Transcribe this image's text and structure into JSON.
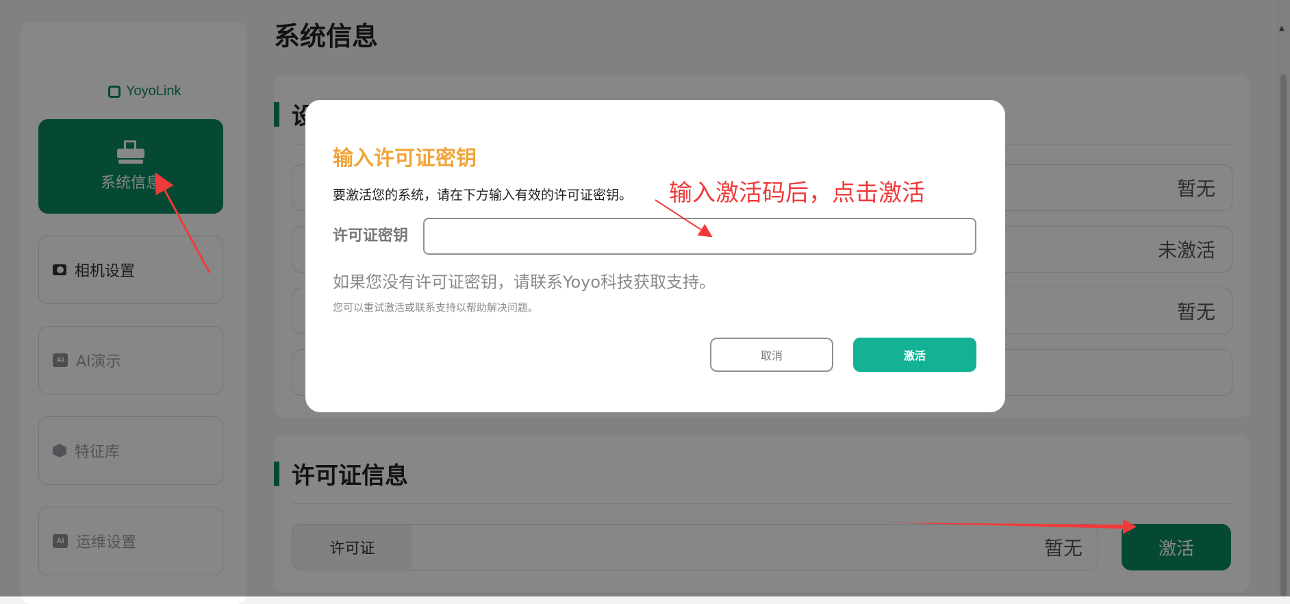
{
  "app": {
    "logo_text": "YoyoLink",
    "page_title": "系统信息"
  },
  "sidebar": {
    "items": [
      {
        "label": "系统信息",
        "icon": "cash-register-icon",
        "state": "active"
      },
      {
        "label": "相机设置",
        "icon": "camera-icon",
        "state": "normal"
      },
      {
        "label": "AI演示",
        "icon": "ai-icon",
        "badge": "AI",
        "state": "disabled"
      },
      {
        "label": "特征库",
        "icon": "box-icon",
        "state": "disabled"
      },
      {
        "label": "运维设置",
        "icon": "ai-icon",
        "badge": "AI",
        "state": "disabled"
      }
    ]
  },
  "device_info": {
    "title": "设备信息",
    "rows": [
      {
        "value": "暂无"
      },
      {
        "value": "未激活"
      },
      {
        "value": "暂无"
      },
      {
        "value": ""
      }
    ]
  },
  "license_info": {
    "title": "许可证信息",
    "label": "许可证",
    "value": "暂无",
    "activate_label": "激活"
  },
  "modal": {
    "title": "输入许可证密钥",
    "description": "要激活您的系统，请在下方输入有效的许可证密钥。",
    "field_label": "许可证密钥",
    "field_value": "",
    "field_placeholder": "",
    "hint_primary": "如果您没有许可证密钥，请联系Yoyo科技获取支持。",
    "hint_secondary": "您可以重试激活或联系支持以帮助解决问题。",
    "cancel_label": "取消",
    "activate_label": "激活"
  },
  "annotation": {
    "text": "输入激活码后，点击激活",
    "color": "#f03a3a"
  },
  "colors": {
    "brand_green": "#0b8a63",
    "modal_activate": "#13b295",
    "modal_title": "#f0a43a"
  }
}
